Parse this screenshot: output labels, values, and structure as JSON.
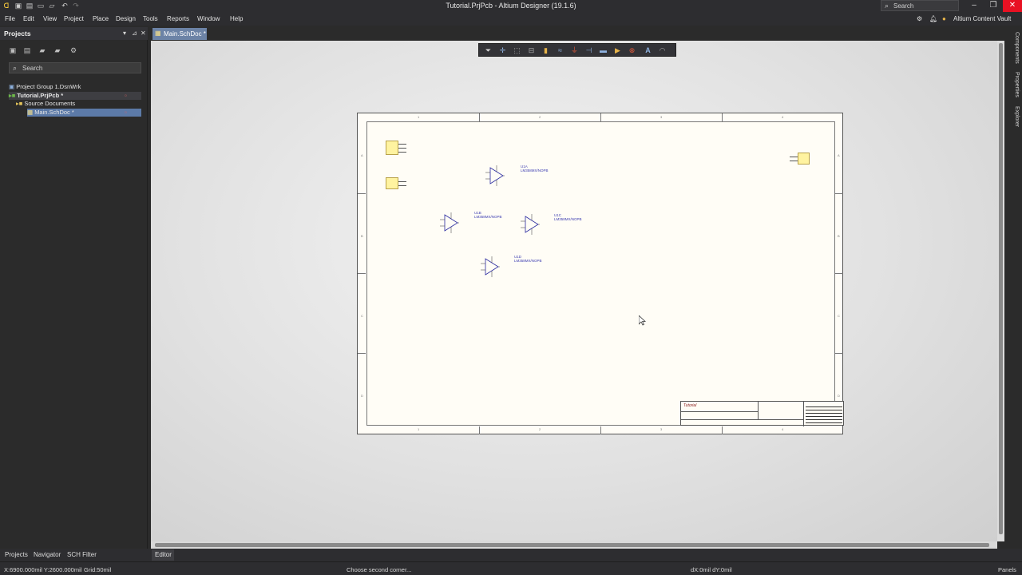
{
  "window": {
    "title": "Tutorial.PrjPcb - Altium Designer (19.1.6)",
    "search_label": "Search",
    "vault_label": "Altium Content Vault"
  },
  "menu": [
    "File",
    "Edit",
    "View",
    "Project",
    "Place",
    "Design",
    "Tools",
    "Reports",
    "Window",
    "Help"
  ],
  "projects_panel": {
    "title": "Projects",
    "search_placeholder": "Search",
    "tree": {
      "group": "Project Group 1.DsnWrk",
      "project": "Tutorial.PrjPcb *",
      "folder": "Source Documents",
      "document": "Main.SchDoc *"
    }
  },
  "document_tab": "Main.SchDoc *",
  "right_panels": [
    "Components",
    "Properties",
    "Explorer"
  ],
  "schematic": {
    "zones_top": [
      "1",
      "2",
      "3",
      "4"
    ],
    "zones_side": [
      "A",
      "B",
      "C",
      "D"
    ],
    "opamps": [
      {
        "ref": "U1A",
        "part": "LM358MX/NOPB"
      },
      {
        "ref": "U1B",
        "part": "LM358MX/NOPB"
      },
      {
        "ref": "U1C",
        "part": "LM358MX/NOPB"
      },
      {
        "ref": "U1D",
        "part": "LM358MX/NOPB"
      }
    ],
    "title_block": {
      "name": "Tutorial"
    }
  },
  "bottom_tabs": [
    "Projects",
    "Navigator",
    "SCH Filter"
  ],
  "editor_tab": "Editor",
  "status": {
    "coords": "X:6900.000mil Y:2600.000mil",
    "grid": "Grid:50mil",
    "message": "Choose second corner...",
    "delta": "dX:0mil dY:0mil",
    "panels": "Panels"
  },
  "colors": {
    "accent": "#6c83a6",
    "close": "#e81123",
    "panel_bg": "#2b2b2b"
  }
}
